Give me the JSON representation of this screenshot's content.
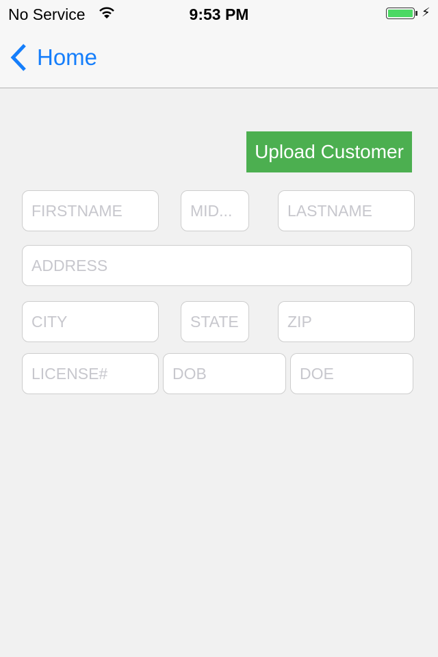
{
  "status_bar": {
    "carrier": "No Service",
    "time": "9:53 PM",
    "battery_level": 1.0,
    "battery_color": "#4cd964",
    "icons": [
      "wifi-icon",
      "battery-icon",
      "charging-bolt-icon"
    ]
  },
  "nav": {
    "back_label": "Home",
    "accent": "#157efb"
  },
  "upload_button": {
    "label": "Upload Customer",
    "color": "#4caf50"
  },
  "form": {
    "firstname": "FIRSTNAME",
    "middle": "MID...",
    "lastname": "LASTNAME",
    "address": "ADDRESS",
    "city": "CITY",
    "state": "STATE",
    "zip": "ZIP",
    "license": "LICENSE#",
    "dob": "DOB",
    "doe": "DOE"
  }
}
